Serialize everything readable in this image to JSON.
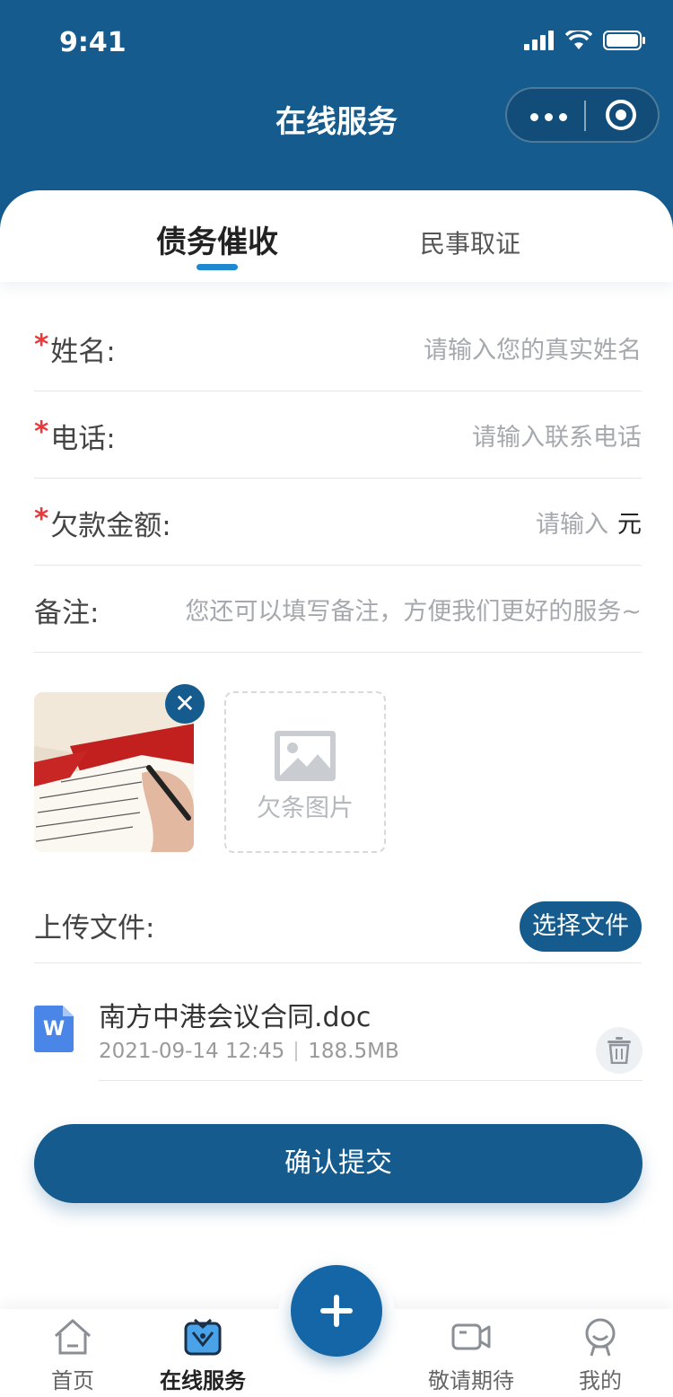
{
  "status_bar": {
    "time": "9:41"
  },
  "nav": {
    "title": "在线服务"
  },
  "tabs": [
    {
      "label": "债务催收",
      "active": true
    },
    {
      "label": "民事取证",
      "active": false
    }
  ],
  "form": {
    "required_mark": "*",
    "fields": [
      {
        "label": "姓名:",
        "required": true,
        "placeholder": "请输入您的真实姓名"
      },
      {
        "label": "电话:",
        "required": true,
        "placeholder": "请输入联系电话"
      },
      {
        "label": "欠款金额:",
        "required": true,
        "placeholder": "请输入",
        "unit": "元"
      },
      {
        "label": "备注:",
        "required": false,
        "placeholder": "您还可以填写备注，方便我们更好的服务~"
      }
    ]
  },
  "images": {
    "uploaded_thumbnail": "iou-photo",
    "remove_icon": "✕",
    "add_slot_label": "欠条图片"
  },
  "upload": {
    "label": "上传文件:",
    "choose_button": "选择文件",
    "files": [
      {
        "name": "南方中港会议合同.doc",
        "date": "2021-09-14 12:45",
        "size": "188.5MB",
        "icon": "word-doc-icon",
        "icon_letter": "W"
      }
    ]
  },
  "submit_label": "确认提交",
  "tabbar": {
    "items": [
      {
        "label": "首页",
        "icon": "home-icon",
        "active": false
      },
      {
        "label": "在线服务",
        "icon": "service-icon",
        "active": true
      },
      {
        "label": "敬请期待",
        "icon": "video-icon",
        "active": false
      },
      {
        "label": "我的",
        "icon": "user-icon",
        "active": false
      }
    ],
    "center_button_icon": "plus-icon"
  },
  "colors": {
    "primary": "#155b8e",
    "accent_underline": "#1e88d0",
    "required": "#e8393b",
    "placeholder": "#a5a9ae",
    "word_icon": "#4a86e8"
  }
}
